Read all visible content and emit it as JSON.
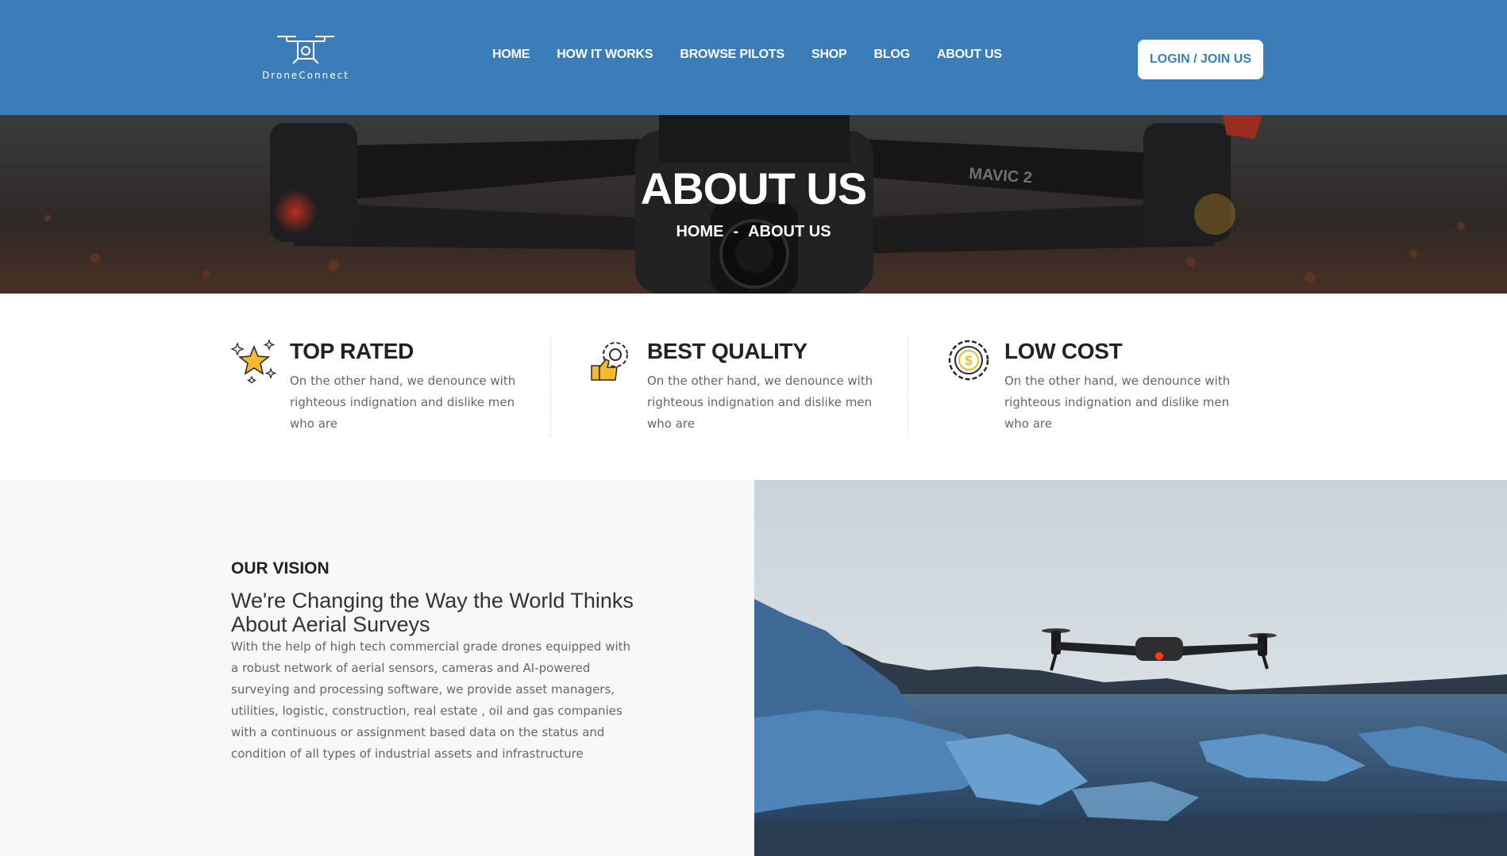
{
  "header": {
    "logo_text": "DroneConnect",
    "nav": [
      "HOME",
      "HOW IT WORKS",
      "BROWSE PILOTS",
      "SHOP",
      "BLOG",
      "ABOUT US"
    ],
    "login_label": "LOGIN / JOIN US"
  },
  "hero": {
    "title": "ABOUT US",
    "breadcrumb": {
      "home": "HOME",
      "separator": "-",
      "current": "ABOUT US"
    },
    "drone_label": "MAVIC 2"
  },
  "features": [
    {
      "title": "TOP RATED",
      "text": "On the other hand, we denounce with righteous indignation and dislike men who are",
      "icon": "star-award-icon"
    },
    {
      "title": "BEST QUALITY",
      "text": "On the other hand, we denounce with righteous indignation and dislike men who are",
      "icon": "gear-thumbs-up-icon"
    },
    {
      "title": "LOW COST",
      "text": "On the other hand, we denounce with righteous indignation and dislike men who are",
      "icon": "dollar-gear-icon"
    }
  ],
  "vision": {
    "label": "OUR VISION",
    "heading": "We're Changing the Way the World Thinks About Aerial Surveys",
    "text": "With the help of high tech commercial grade drones equipped with a robust network of aerial sensors, cameras and AI-powered surveying and processing software, we provide asset managers, utilities, logistic, construction, real estate , oil and gas companies with a continuous or assignment based data on the status and condition of all types of industrial assets and infrastructure"
  },
  "colors": {
    "brand": "#3b7db8",
    "accent": "#f5b82e",
    "text_dark": "#222222",
    "text_muted": "#666666"
  }
}
